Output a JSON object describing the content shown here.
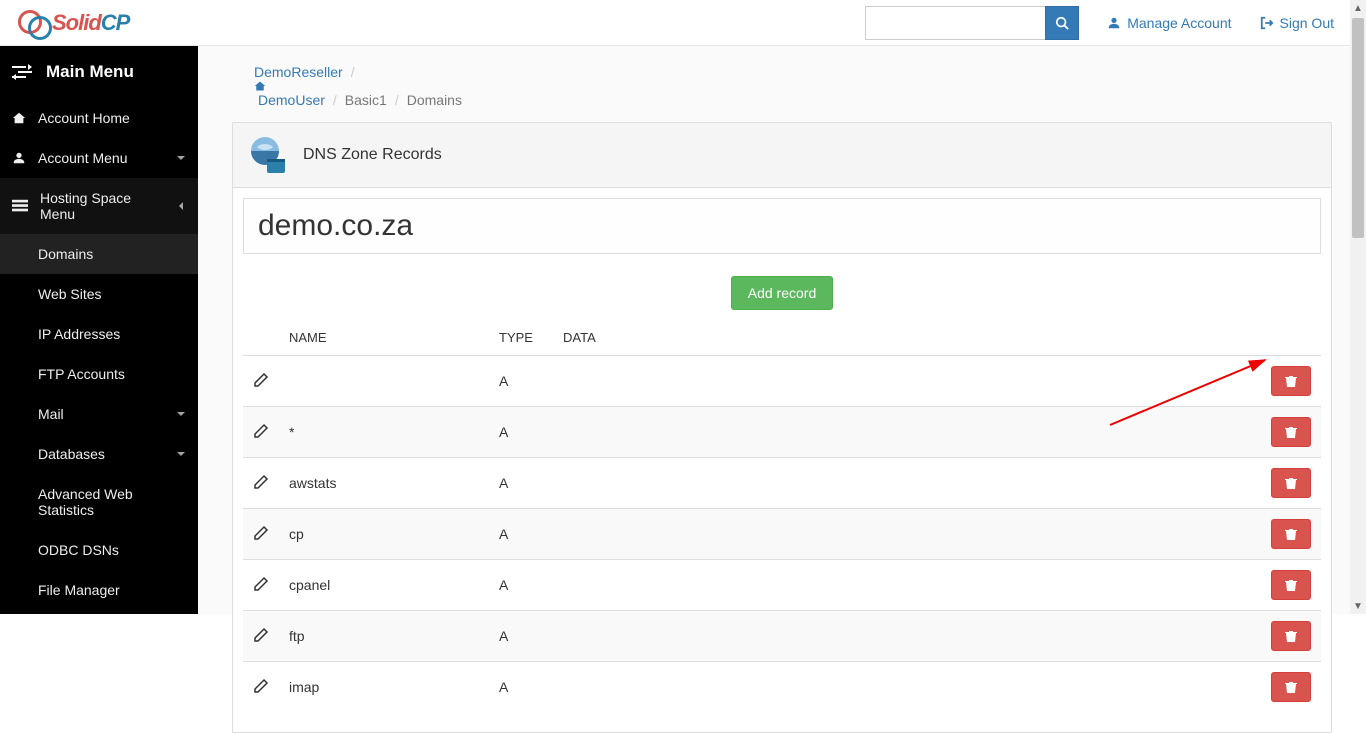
{
  "brand": {
    "prefix": "Solid",
    "suffix": "CP"
  },
  "toplinks": {
    "manage_account": "Manage Account",
    "sign_out": "Sign Out"
  },
  "search": {
    "placeholder": ""
  },
  "sidebar": {
    "title": "Main Menu",
    "items": [
      {
        "label": "Account Home",
        "icon": "home"
      },
      {
        "label": "Account Menu",
        "icon": "user",
        "chev": "down"
      },
      {
        "label": "Hosting Space Menu",
        "icon": "layers",
        "chev": "left",
        "open": true
      }
    ],
    "sub": [
      {
        "label": "Domains",
        "active": true
      },
      {
        "label": "Web Sites"
      },
      {
        "label": "IP Addresses"
      },
      {
        "label": "FTP Accounts"
      },
      {
        "label": "Mail",
        "chev": "down"
      },
      {
        "label": "Databases",
        "chev": "down"
      },
      {
        "label": "Advanced Web Statistics"
      },
      {
        "label": "ODBC DSNs"
      },
      {
        "label": "File Manager"
      }
    ]
  },
  "breadcrumbs": {
    "items": [
      {
        "label": "DemoReseller",
        "link": true
      },
      {
        "label": "DemoUser",
        "link": true,
        "home": true
      },
      {
        "label": "Basic1",
        "link": false
      },
      {
        "label": "Domains",
        "link": false
      }
    ]
  },
  "page": {
    "title": "DNS Zone Records",
    "domain": "demo.co.za",
    "add_button": "Add record"
  },
  "table": {
    "columns": {
      "name": "NAME",
      "type": "TYPE",
      "data": "DATA"
    },
    "rows": [
      {
        "name": "",
        "type": "A",
        "data": ""
      },
      {
        "name": "*",
        "type": "A",
        "data": ""
      },
      {
        "name": "awstats",
        "type": "A",
        "data": ""
      },
      {
        "name": "cp",
        "type": "A",
        "data": ""
      },
      {
        "name": "cpanel",
        "type": "A",
        "data": ""
      },
      {
        "name": "ftp",
        "type": "A",
        "data": ""
      },
      {
        "name": "imap",
        "type": "A",
        "data": ""
      }
    ]
  }
}
